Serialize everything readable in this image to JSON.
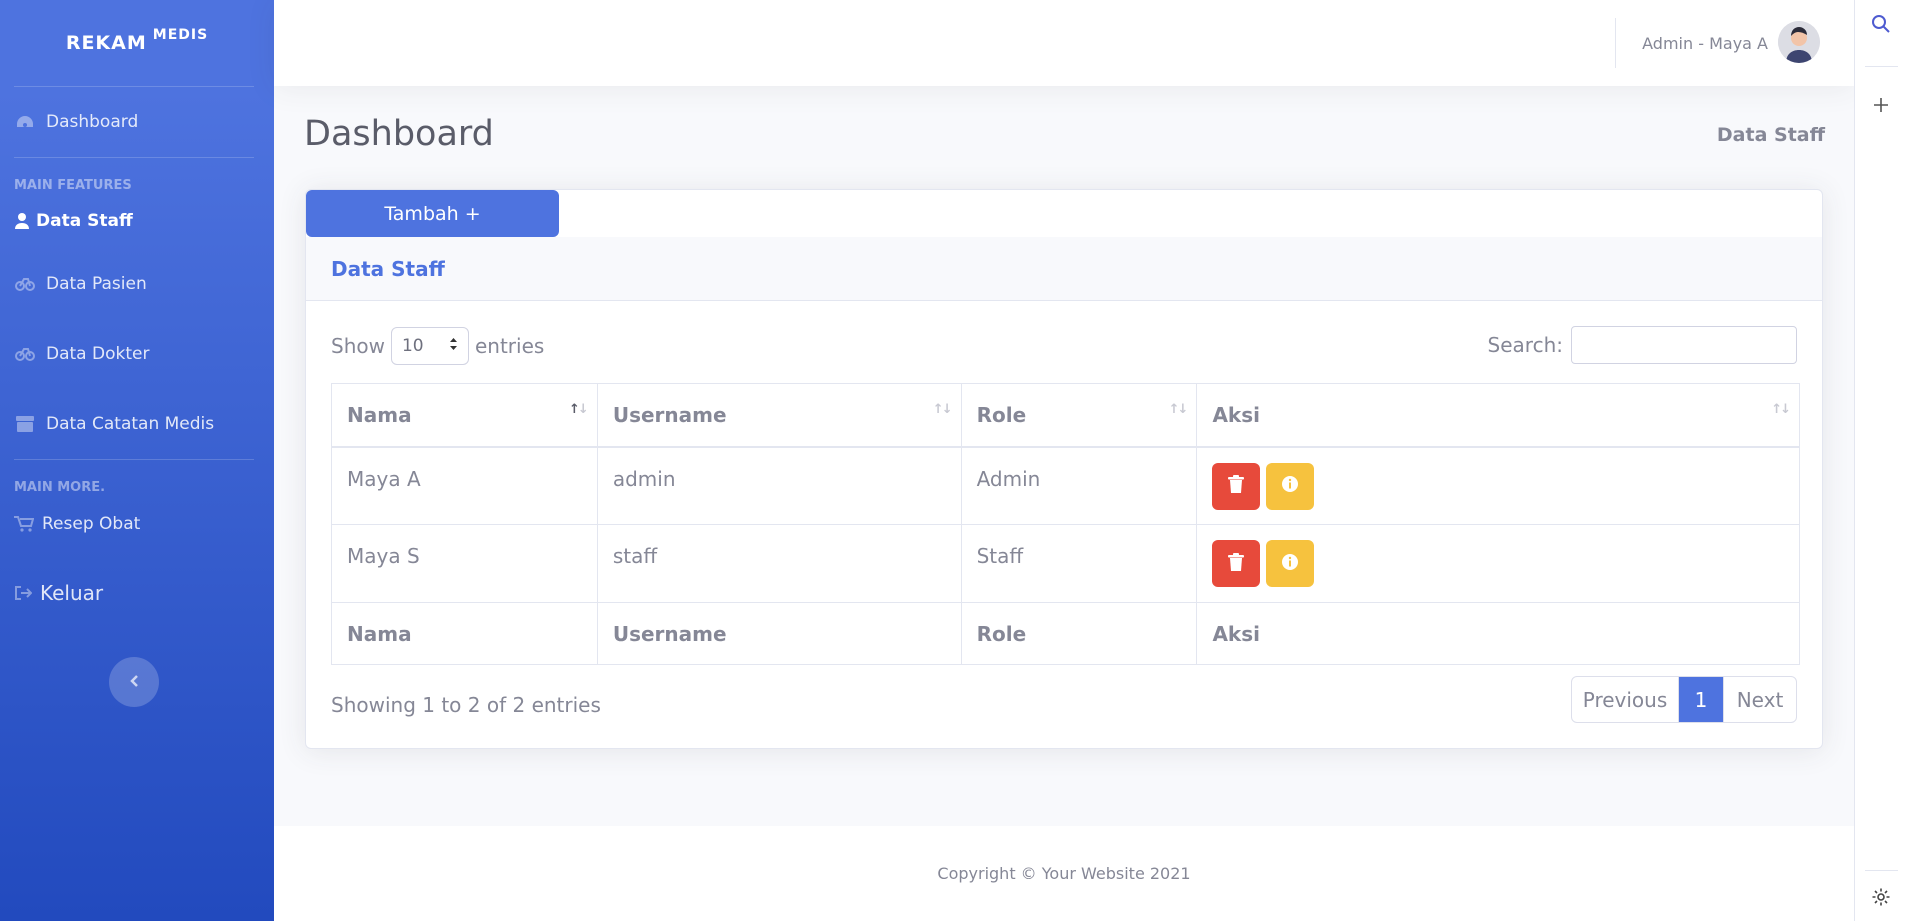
{
  "sidebar": {
    "brand": {
      "main": "REKAM",
      "sup": "MEDIS"
    },
    "dashboard_label": "Dashboard",
    "heading_features": "MAIN FEATURES",
    "items": [
      {
        "label": "Data Staff",
        "icon": "user-icon"
      },
      {
        "label": "Data Pasien",
        "icon": "gauge-icon"
      },
      {
        "label": "Data Dokter",
        "icon": "gauge-icon"
      },
      {
        "label": "Data Catatan Medis",
        "icon": "box-icon"
      }
    ],
    "heading_more": "MAIN MORE.",
    "resep_label": "Resep Obat",
    "logout_label": "Keluar"
  },
  "topbar": {
    "user_label": "Admin - Maya A"
  },
  "page": {
    "title": "Dashboard",
    "breadcrumb": "Data Staff"
  },
  "card": {
    "add_button": "Tambah +",
    "header_title": "Data Staff",
    "show_label": "Show",
    "entries_label": "entries",
    "page_length": "10",
    "search_label": "Search:",
    "search_value": ""
  },
  "table": {
    "columns": [
      "Nama",
      "Username",
      "Role",
      "Aksi"
    ],
    "rows": [
      {
        "nama": "Maya A",
        "username": "admin",
        "role": "Admin"
      },
      {
        "nama": "Maya S",
        "username": "staff",
        "role": "Staff"
      }
    ],
    "footer_columns": [
      "Nama",
      "Username",
      "Role",
      "Aksi"
    ]
  },
  "pagination": {
    "info": "Showing 1 to 2 of 2 entries",
    "previous": "Previous",
    "current": "1",
    "next": "Next"
  },
  "footer": {
    "copyright": "Copyright © Your Website 2021"
  },
  "colors": {
    "primary": "#4e73df",
    "danger": "#e74a3b",
    "warning": "#f6c23e"
  }
}
